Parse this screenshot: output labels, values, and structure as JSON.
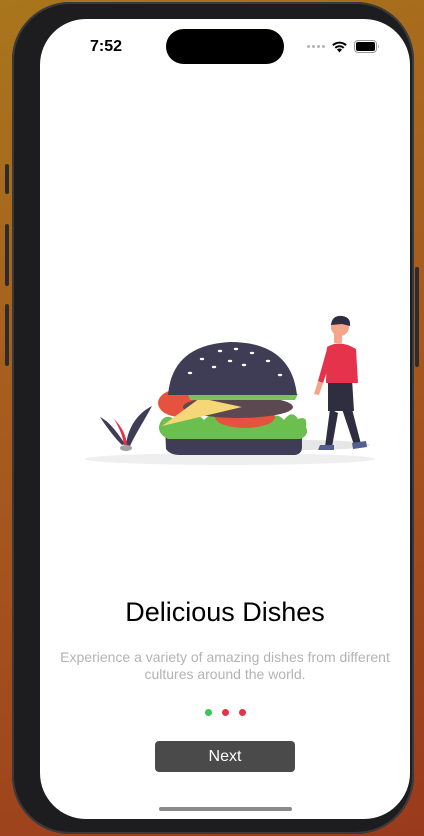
{
  "status_bar": {
    "time": "7:52",
    "icons": [
      "cellular-signal-icon",
      "wifi-icon",
      "battery-icon"
    ]
  },
  "onboarding": {
    "title": "Delicious Dishes",
    "description": "Experience a variety of amazing dishes from different cultures around the world.",
    "illustration": "burger-and-person-illustration",
    "page_indicator": {
      "total": 3,
      "active_index": 0,
      "active_color": "#34c759",
      "inactive_color": "#e5334b"
    },
    "next_button_label": "Next"
  },
  "colors": {
    "button_background": "#4a4a4a",
    "description_text": "#b3b3b3",
    "bun": "#3f3d56",
    "accent_red": "#e5334b"
  }
}
